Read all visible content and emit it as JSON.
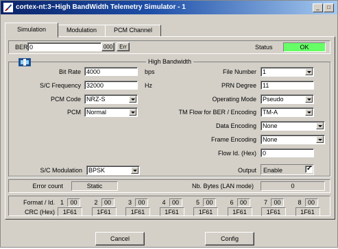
{
  "window": {
    "title": "cortex-nt:3~High BandWidth Telemetry Simulator - 1",
    "min": "_",
    "max": "□"
  },
  "tabs": [
    {
      "label": "Simulation",
      "active": true
    },
    {
      "label": "Modulation",
      "active": false
    },
    {
      "label": "PCM Channel",
      "active": false
    }
  ],
  "ber": {
    "label": "BER",
    "value": "0",
    "btn_ber": "000",
    "btn_err": "Err"
  },
  "status": {
    "label": "Status",
    "value": "OK",
    "color": "#66ff66"
  },
  "group": {
    "title": "High Bandwidth"
  },
  "left": {
    "bitrate": {
      "label": "Bit Rate",
      "value": "4000",
      "unit": "bps"
    },
    "scfreq": {
      "label": "S/C Frequency",
      "value": "32000",
      "unit": "Hz"
    },
    "pcmcode": {
      "label": "PCM Code",
      "value": "NRZ-S"
    },
    "pcm": {
      "label": "PCM",
      "value": "Normal"
    },
    "scmod": {
      "label": "S/C Modulation",
      "value": "BPSK"
    }
  },
  "right": {
    "filenum": {
      "label": "File Number",
      "value": "1"
    },
    "prn": {
      "label": "PRN Degree",
      "value": "11"
    },
    "opmode": {
      "label": "Operating Mode",
      "value": "Pseudo"
    },
    "tmflow": {
      "label": "TM Flow for BER / Encoding",
      "value": "TM-A"
    },
    "dataenc": {
      "label": "Data Encoding",
      "value": "None"
    },
    "frameenc": {
      "label": "Frame Encoding",
      "value": "None"
    },
    "flowid": {
      "label": "Flow Id. (Hex)",
      "value": "0"
    },
    "output": {
      "label": "Output",
      "value": "Enable",
      "checked": true
    }
  },
  "counts": {
    "error_label": "Error count",
    "error_value": "Static",
    "bytes_label": "Nb. Bytes (LAN mode)",
    "bytes_value": "0"
  },
  "format": {
    "label": "Format / Id.",
    "crc_label": "CRC (Hex)",
    "items": [
      {
        "num": "1",
        "id": "00",
        "crc": "1F61"
      },
      {
        "num": "2",
        "id": "00",
        "crc": "1F61"
      },
      {
        "num": "3",
        "id": "00",
        "crc": "1F61"
      },
      {
        "num": "4",
        "id": "00",
        "crc": "1F61"
      },
      {
        "num": "5",
        "id": "00",
        "crc": "1F61"
      },
      {
        "num": "6",
        "id": "00",
        "crc": "1F61"
      },
      {
        "num": "7",
        "id": "00",
        "crc": "1F61"
      },
      {
        "num": "8",
        "id": "00",
        "crc": "1F61"
      }
    ]
  },
  "buttons": {
    "cancel": "Cancel",
    "config": "Config"
  }
}
